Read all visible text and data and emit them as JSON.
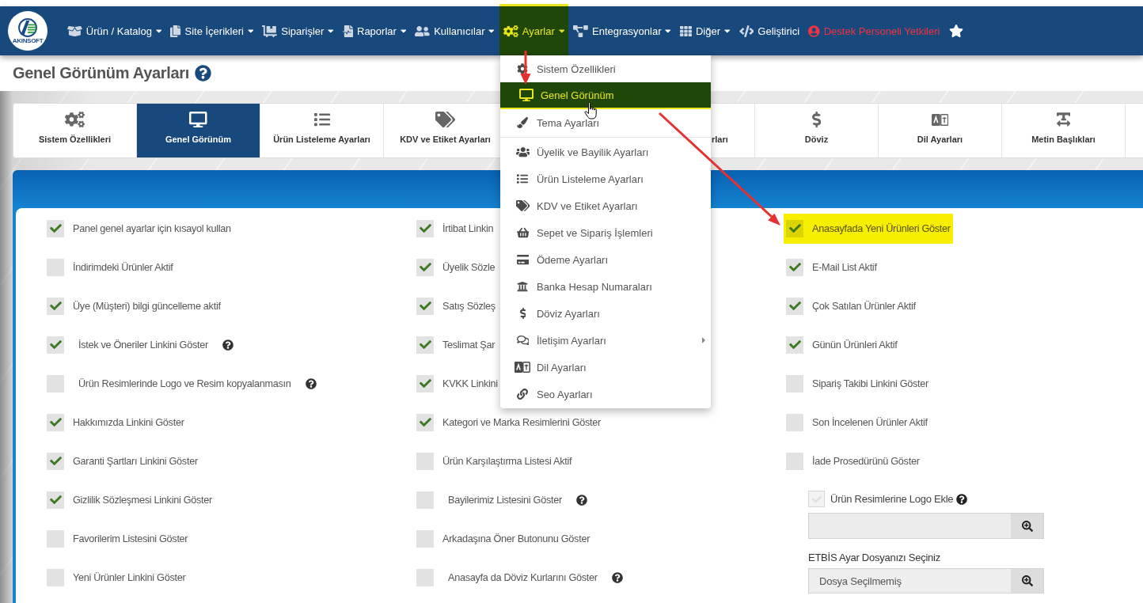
{
  "logo": {
    "text": "AKINSOFT"
  },
  "nav": {
    "items": [
      {
        "label": "Ürün / Katalog",
        "kind": "dropdown",
        "selected": false
      },
      {
        "label": "Site İçerikleri",
        "kind": "dropdown",
        "selected": false
      },
      {
        "label": "Siparişler",
        "kind": "dropdown",
        "selected": false
      },
      {
        "label": "Raporlar",
        "kind": "dropdown",
        "selected": false
      },
      {
        "label": "Kullanıcılar",
        "kind": "dropdown",
        "selected": false
      },
      {
        "label": "Ayarlar",
        "kind": "dropdown",
        "selected": true
      },
      {
        "label": "Entegrasyonlar",
        "kind": "dropdown",
        "selected": false
      },
      {
        "label": "Diğer",
        "kind": "dropdown",
        "selected": false
      },
      {
        "label": "Geliştirici",
        "kind": "link",
        "selected": false
      },
      {
        "label": "Destek Personeli Yetkileri",
        "kind": "alert",
        "selected": false
      },
      {
        "kind": "icon",
        "selected": false
      }
    ]
  },
  "settings_menu": {
    "sections": [
      {
        "items": [
          {
            "label": "Sistem Özellikleri",
            "selected": false,
            "has_submenu": false
          },
          {
            "label": "Genel Görünüm",
            "selected": true,
            "has_submenu": false
          },
          {
            "label": "Tema Ayarları",
            "selected": false,
            "has_submenu": false
          }
        ]
      },
      {
        "items": [
          {
            "label": "Üyelik ve Bayilik Ayarları",
            "selected": false,
            "has_submenu": false
          },
          {
            "label": "Ürün Listeleme Ayarları",
            "selected": false,
            "has_submenu": false
          },
          {
            "label": "KDV ve Etiket Ayarları",
            "selected": false,
            "has_submenu": false
          },
          {
            "label": "Sepet ve Sipariş İşlemleri",
            "selected": false,
            "has_submenu": false
          },
          {
            "label": "Ödeme Ayarları",
            "selected": false,
            "has_submenu": false
          },
          {
            "label": "Banka Hesap Numaraları",
            "selected": false,
            "has_submenu": false
          },
          {
            "label": "Döviz Ayarları",
            "selected": false,
            "has_submenu": false
          },
          {
            "label": "İletişim Ayarları",
            "selected": false,
            "has_submenu": true
          },
          {
            "label": "Dil Ayarları",
            "selected": false,
            "has_submenu": false
          },
          {
            "label": "Seo Ayarları",
            "selected": false,
            "has_submenu": false
          }
        ]
      }
    ]
  },
  "page": {
    "title": "Genel Görünüm Ayarları"
  },
  "tabs": [
    {
      "label": "Sistem Özellikleri",
      "kind": "full",
      "selected": false
    },
    {
      "label": "Genel Görünüm",
      "kind": "full",
      "selected": true
    },
    {
      "label": "Ürün Listeleme Ayarları",
      "kind": "full",
      "selected": false
    },
    {
      "label": "KDV ve Etiket Ayarları",
      "kind": "full",
      "selected": false
    },
    {
      "label": "rları",
      "kind": "partial",
      "selected": false
    },
    {
      "label": "Döviz",
      "kind": "full",
      "selected": false
    },
    {
      "label": "Dil Ayarları",
      "kind": "full",
      "selected": false
    },
    {
      "label": "Metin Başlıkları",
      "kind": "full",
      "selected": false
    }
  ],
  "options": {
    "columns": [
      {
        "items": [
          {
            "label": "Panel genel ayarlar için kısayol kullan",
            "kind": "plain",
            "checked": true,
            "highlighted": false
          },
          {
            "label": "İndirimdeki Ürünler Aktif",
            "kind": "plain",
            "checked": false,
            "highlighted": false
          },
          {
            "label": "Üye (Müşteri) bilgi güncelleme aktif",
            "kind": "plain",
            "checked": true,
            "highlighted": false
          },
          {
            "label": "İstek ve Öneriler Linkini Göster",
            "kind": "help",
            "checked": true,
            "highlighted": false
          },
          {
            "label": "Ürün Resimlerinde Logo ve Resim kopyalanmasın",
            "kind": "help",
            "checked": false,
            "highlighted": false
          },
          {
            "label": "Hakkımızda Linkini Göster",
            "kind": "plain",
            "checked": true,
            "highlighted": false
          },
          {
            "label": "Garanti Şartları Linkini Göster",
            "kind": "plain",
            "checked": true,
            "highlighted": false
          },
          {
            "label": "Gizlilik Sözleşmesi Linkini Göster",
            "kind": "plain",
            "checked": true,
            "highlighted": false
          },
          {
            "label": "Favorilerim Listesini Göster",
            "kind": "plain",
            "checked": false,
            "highlighted": false
          },
          {
            "label": "Yeni Ürünler Linkini Göster",
            "kind": "plain",
            "checked": false,
            "highlighted": false
          }
        ]
      },
      {
        "items": [
          {
            "label": "İrtibat Linkin",
            "kind": "plain",
            "checked": true,
            "highlighted": false
          },
          {
            "label": "Üyelik Sözle",
            "kind": "plain",
            "checked": true,
            "highlighted": false
          },
          {
            "label": "Satış Sözleş",
            "kind": "plain",
            "checked": true,
            "highlighted": false
          },
          {
            "label": "Teslimat Şar",
            "kind": "plain",
            "checked": true,
            "highlighted": false
          },
          {
            "label": "KVKK Linkini",
            "kind": "plain",
            "checked": true,
            "highlighted": false
          },
          {
            "label": "Kategori ve Marka Resimlerini Göster",
            "kind": "plain",
            "checked": true,
            "highlighted": false
          },
          {
            "label": "Ürün Karşılaştırma Listesi Aktif",
            "kind": "plain",
            "checked": false,
            "highlighted": false
          },
          {
            "label": "Bayilerimiz Listesini Göster",
            "kind": "help",
            "checked": false,
            "highlighted": false
          },
          {
            "label": "Arkadaşına Öner Butonunu Göster",
            "kind": "plain",
            "checked": false,
            "highlighted": false
          },
          {
            "label": "Anasayfa da Döviz Kurlarını Göster",
            "kind": "help",
            "checked": false,
            "highlighted": false
          }
        ]
      },
      {
        "items": [
          {
            "label": "Anasayfada Yeni Ürünleri Göster",
            "kind": "plain",
            "checked": true,
            "highlighted": true
          },
          {
            "label": "E-Mail List Aktif",
            "kind": "plain",
            "checked": true,
            "highlighted": false
          },
          {
            "label": "Çok Satılan Ürünler Aktif",
            "kind": "plain",
            "checked": true,
            "highlighted": false
          },
          {
            "label": "Günün Ürünleri Aktif",
            "kind": "plain",
            "checked": true,
            "highlighted": false
          },
          {
            "label": "Sipariş Takibi Linkini Göster",
            "kind": "plain",
            "checked": false,
            "highlighted": false
          },
          {
            "label": "Son İncelenen Ürünler Aktif",
            "kind": "plain",
            "checked": false,
            "highlighted": false
          },
          {
            "label": "İade Prosedürünü Göster",
            "kind": "plain",
            "checked": false,
            "highlighted": false
          }
        ],
        "logo_upload": {
          "label": "Ürün Resimlerine Logo Ekle",
          "checked": true,
          "disabled": true
        },
        "file_select": {
          "label": "ETBİS Ayar Dosyanızı Seçiniz",
          "value": "Dosya Seçilmemiş"
        }
      }
    ]
  },
  "annotations": [
    {
      "kind": "arrow"
    },
    {
      "kind": "arrow"
    },
    {
      "kind": "pointer"
    }
  ]
}
